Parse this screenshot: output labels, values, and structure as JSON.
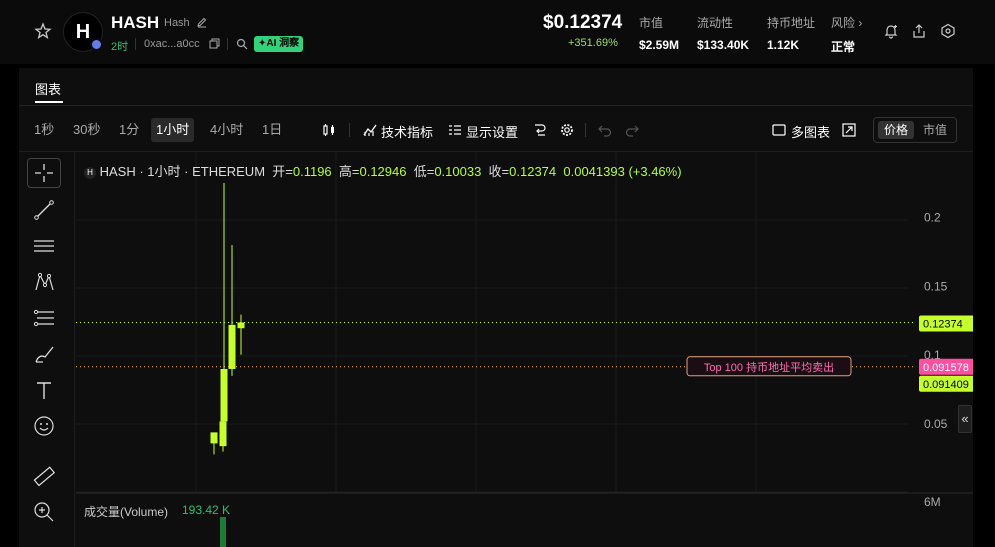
{
  "token": {
    "logo_letter": "H",
    "symbol": "HASH",
    "name": "Hash",
    "age": "2时",
    "address": "0xac...a0cc",
    "ai_badge": "AI 洞察"
  },
  "price": {
    "value": "$0.12374",
    "change": "+351.69%"
  },
  "stats": [
    {
      "label": "市值",
      "value": "$2.59M"
    },
    {
      "label": "流动性",
      "value": "$133.40K"
    },
    {
      "label": "持币地址",
      "value": "1.12K"
    },
    {
      "label": "风险 ›",
      "value": "正常"
    }
  ],
  "tabs": {
    "chart": "图表"
  },
  "toolbar": {
    "timeframes": [
      "1秒",
      "30秒",
      "1分",
      "1小时",
      "4小时",
      "1日"
    ],
    "active_timeframe": "1小时",
    "indicators": "技术指标",
    "display_settings": "显示设置",
    "multi_chart": "多图表",
    "toggle_price": "价格",
    "toggle_mcap": "市值"
  },
  "legend": {
    "title": "HASH · 1小时 · ETHEREUM",
    "open_label": "开=",
    "open": "0.1196",
    "high_label": "高=",
    "high": "0.12946",
    "low_label": "低=",
    "low": "0.10033",
    "close_label": "收=",
    "close": "0.12374",
    "change": "0.0041393 (+3.46%)"
  },
  "volume": {
    "label": "成交量(Volume)",
    "value": "193.42 K"
  },
  "annotation": "Top 100 持币地址平均卖出",
  "colors": {
    "up": "#c6ff2e",
    "avg_sell": "#ff4fa0",
    "price_line": "#c6ff2e",
    "volume_bar": "#1f7a3a"
  },
  "chart_data": {
    "type": "candlestick",
    "y_ticks": [
      "0.2",
      "0.15",
      "0.1",
      "0.05"
    ],
    "volume_tick": "6M",
    "current_price_label": "0.12374",
    "avg_sell_label": "0.091578",
    "lower_label": "0.091409",
    "candles": [
      {
        "open": 0.036,
        "high": 0.041,
        "low": 0.028,
        "close": 0.044
      },
      {
        "open": 0.034,
        "high": 0.07,
        "low": 0.03,
        "close": 0.052
      },
      {
        "open": 0.052,
        "high": 0.225,
        "low": 0.048,
        "close": 0.09
      },
      {
        "open": 0.09,
        "high": 0.18,
        "low": 0.085,
        "close": 0.122
      },
      {
        "open": 0.1196,
        "high": 0.12946,
        "low": 0.10033,
        "close": 0.12374
      }
    ],
    "avg_sell_price": 0.091578,
    "ylim": [
      0.0,
      0.25
    ]
  }
}
